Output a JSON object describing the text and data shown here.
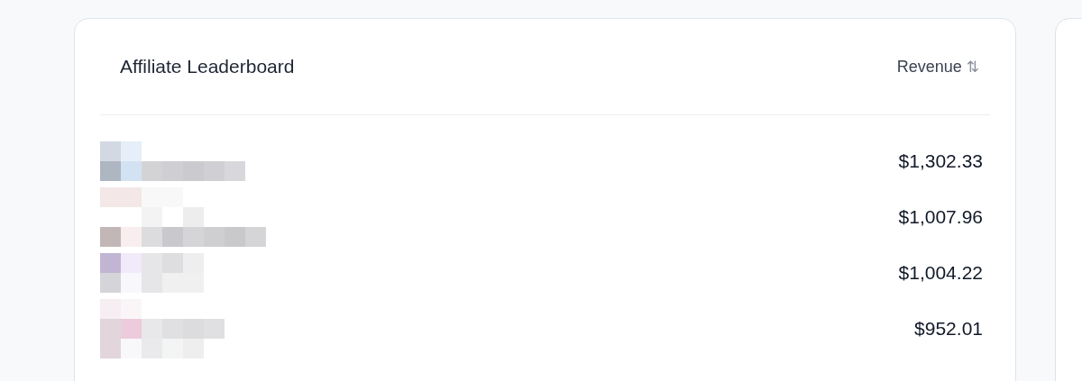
{
  "leaderboard": {
    "title": "Affiliate Leaderboard",
    "sort": {
      "label": "Revenue",
      "icon": "⇅"
    },
    "rows": [
      {
        "revenue": "$1,302.33"
      },
      {
        "revenue": "$1,007.96"
      },
      {
        "revenue": "$1,004.22"
      },
      {
        "revenue": "$952.01"
      }
    ]
  }
}
